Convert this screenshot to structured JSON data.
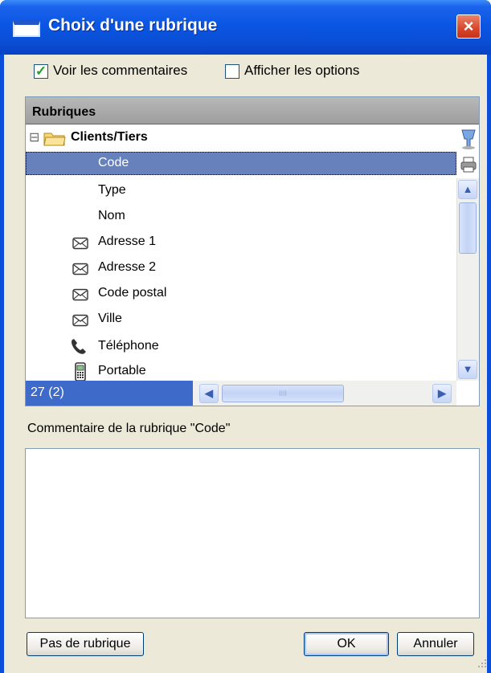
{
  "window": {
    "title": "Choix d'une rubrique",
    "close_glyph": "×"
  },
  "options": {
    "show_comments": {
      "label": "Voir les commentaires",
      "checked": true
    },
    "show_options": {
      "label": "Afficher les options",
      "checked": false
    }
  },
  "tree": {
    "header": "Rubriques",
    "group": {
      "label": "Clients/Tiers",
      "toggle": "⊟"
    },
    "items": [
      {
        "label": "Code",
        "icon": "none",
        "selected": true
      },
      {
        "label": "Type",
        "icon": "none",
        "selected": false
      },
      {
        "label": "Nom",
        "icon": "none",
        "selected": false
      },
      {
        "label": "Adresse 1",
        "icon": "envelope-icon",
        "selected": false
      },
      {
        "label": "Adresse 2",
        "icon": "envelope-icon",
        "selected": false
      },
      {
        "label": "Code postal",
        "icon": "envelope-icon",
        "selected": false
      },
      {
        "label": "Ville",
        "icon": "envelope-icon",
        "selected": false
      },
      {
        "label": "Téléphone",
        "icon": "phone-icon",
        "selected": false
      },
      {
        "label": "Portable",
        "icon": "mobile-phone-icon",
        "selected": false
      }
    ],
    "status": "27 (2)",
    "hscroll_grip": "IIII"
  },
  "comment": {
    "label": "Commentaire de la rubrique \"Code\"",
    "value": ""
  },
  "buttons": {
    "none": "Pas de rubrique",
    "ok": "OK",
    "cancel": "Annuler"
  }
}
